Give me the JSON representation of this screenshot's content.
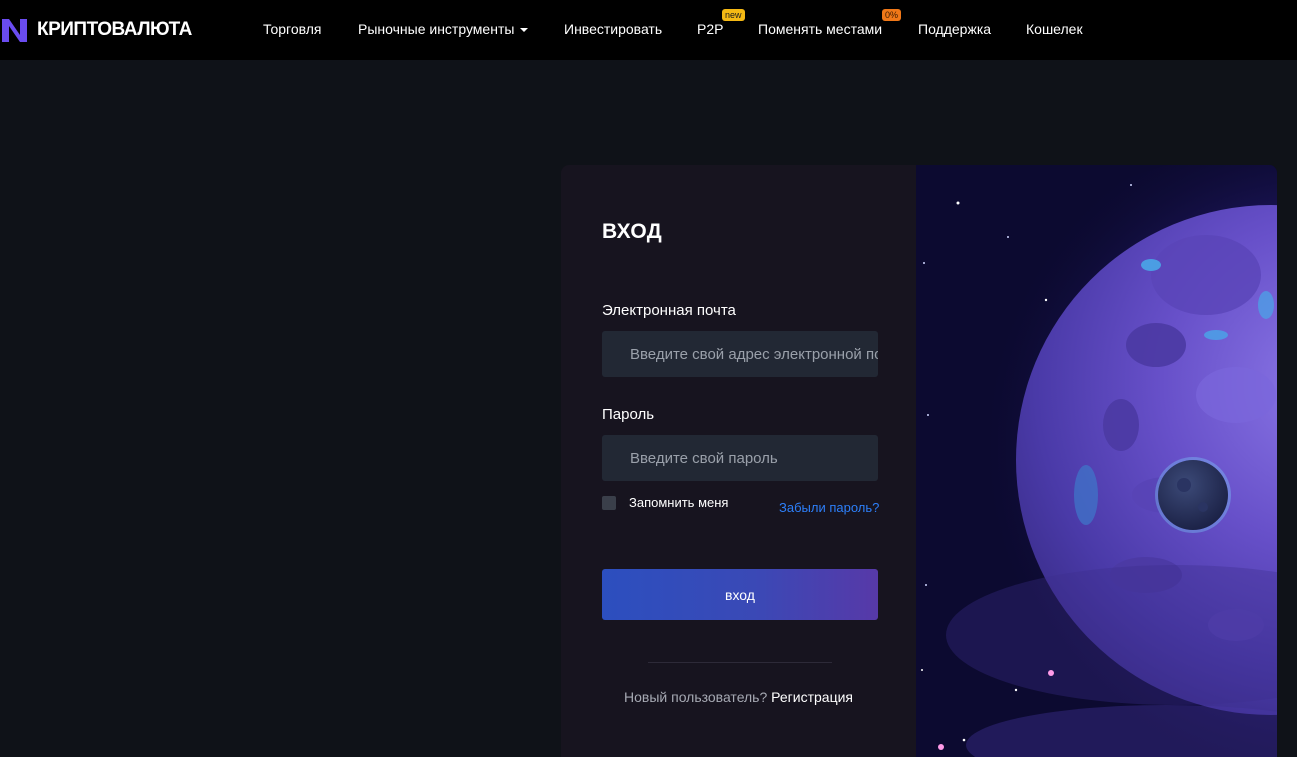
{
  "brand": {
    "name": "КРИПТОВАЛЮТА",
    "logo_color": "#6a4cf0"
  },
  "nav": {
    "items": [
      {
        "label": "Торговля"
      },
      {
        "label": "Рыночные инструменты",
        "has_dropdown": true
      },
      {
        "label": "Инвестировать"
      },
      {
        "label": "P2P",
        "badge": "new"
      },
      {
        "label": "Поменять местами",
        "badge": "0%"
      },
      {
        "label": "Поддержка"
      },
      {
        "label": "Кошелек"
      }
    ]
  },
  "login": {
    "title": "ВХОД",
    "email_label": "Электронная почта",
    "email_placeholder": "Введите свой адрес электронной почты",
    "password_label": "Пароль",
    "password_placeholder": "Введите свой пароль",
    "remember_label": "Запомнить меня",
    "remember_checked": false,
    "forgot_label": "Забыли пароль?",
    "submit_label": "вход",
    "new_user_text": "Новый пользователь? ",
    "register_label": "Регистрация"
  },
  "colors": {
    "page_bg": "#0f1218",
    "nav_bg": "#000000",
    "form_bg": "#17141f",
    "input_bg": "#222834",
    "link": "#2d7ff9",
    "button_from": "#2c4fbf",
    "button_to": "#5739a8",
    "badge_new": "#f5b914",
    "badge_zero": "#f07818"
  }
}
